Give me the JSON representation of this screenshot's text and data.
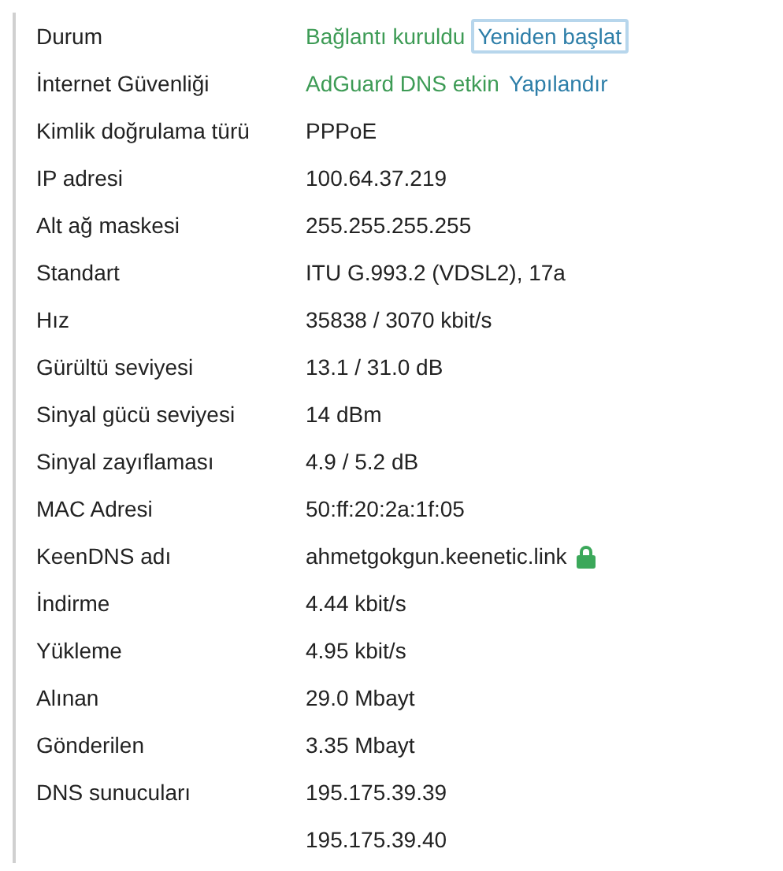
{
  "rows": [
    {
      "label": "Durum",
      "values": [
        {
          "kind": "status",
          "text": "Bağlantı kuruldu"
        },
        {
          "kind": "button",
          "text": "Yeniden başlat",
          "focused": true
        }
      ]
    },
    {
      "label": "İnternet Güvenliği",
      "values": [
        {
          "kind": "status",
          "text": "AdGuard DNS etkin"
        },
        {
          "kind": "link",
          "text": "Yapılandır"
        }
      ]
    },
    {
      "label": "Kimlik doğrulama türü",
      "values": [
        {
          "kind": "text",
          "text": "PPPoE"
        }
      ]
    },
    {
      "label": "IP adresi",
      "values": [
        {
          "kind": "text",
          "text": "100.64.37.219"
        }
      ]
    },
    {
      "label": "Alt ağ maskesi",
      "values": [
        {
          "kind": "text",
          "text": "255.255.255.255"
        }
      ]
    },
    {
      "label": "Standart",
      "values": [
        {
          "kind": "text",
          "text": "ITU G.993.2 (VDSL2), 17a"
        }
      ]
    },
    {
      "label": "Hız",
      "values": [
        {
          "kind": "text",
          "text": "35838 / 3070 kbit/s"
        }
      ]
    },
    {
      "label": "Gürültü seviyesi",
      "values": [
        {
          "kind": "text",
          "text": "13.1 / 31.0 dB"
        }
      ]
    },
    {
      "label": "Sinyal gücü seviyesi",
      "values": [
        {
          "kind": "text",
          "text": "14 dBm"
        }
      ]
    },
    {
      "label": "Sinyal zayıflaması",
      "values": [
        {
          "kind": "text",
          "text": "4.9 / 5.2 dB"
        }
      ]
    },
    {
      "label": "MAC Adresi",
      "values": [
        {
          "kind": "text",
          "text": "50:ff:20:2a:1f:05"
        }
      ]
    },
    {
      "label": "KeenDNS adı",
      "secured": true,
      "values": [
        {
          "kind": "text",
          "text": "ahmetgokgun.keenetic.link"
        }
      ]
    },
    {
      "label": "İndirme",
      "values": [
        {
          "kind": "text",
          "text": "4.44 kbit/s"
        }
      ]
    },
    {
      "label": "Yükleme",
      "values": [
        {
          "kind": "text",
          "text": "4.95 kbit/s"
        }
      ]
    },
    {
      "label": "Alınan",
      "values": [
        {
          "kind": "text",
          "text": "29.0 Mbayt"
        }
      ]
    },
    {
      "label": "Gönderilen",
      "values": [
        {
          "kind": "text",
          "text": "3.35 Mbayt"
        }
      ]
    },
    {
      "label": "DNS sunucuları",
      "values": [
        {
          "kind": "text",
          "text": "195.175.39.39"
        }
      ]
    },
    {
      "values": [
        {
          "kind": "text",
          "text": "195.175.39.40"
        }
      ]
    }
  ]
}
